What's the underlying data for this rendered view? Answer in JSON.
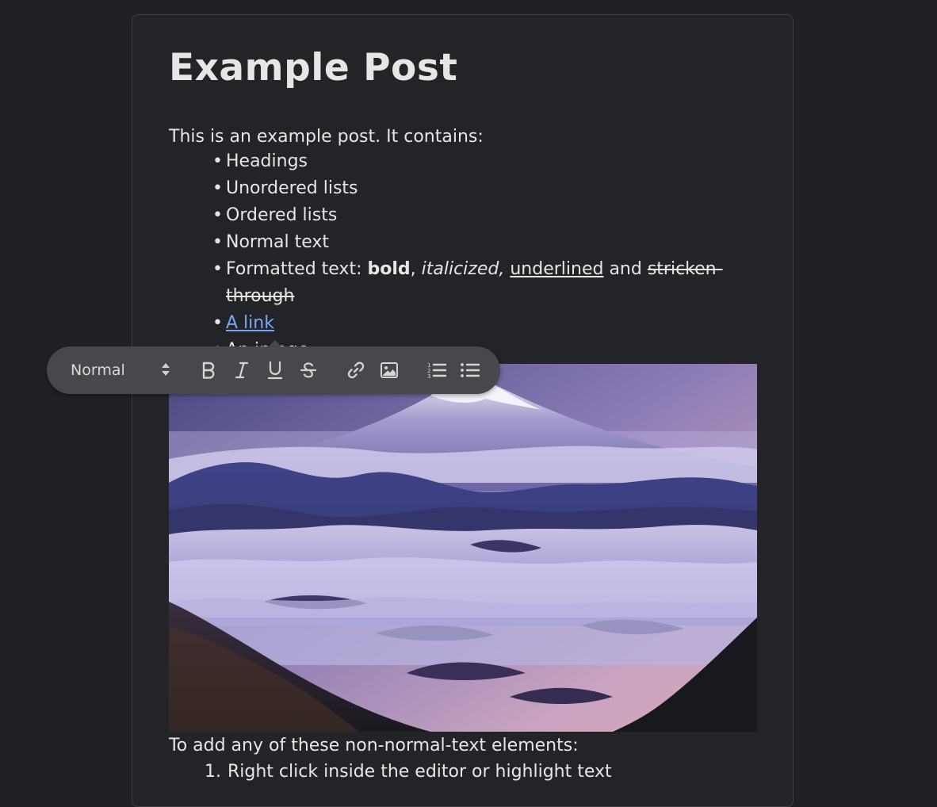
{
  "post": {
    "title": "Example Post",
    "intro": "This is an example post. It contains:",
    "items": [
      "Headings",
      "Unordered lists",
      "Ordered lists",
      "Normal text"
    ],
    "formatted": {
      "prefix": "Formatted text: ",
      "bold": "bold",
      "comma1": ", ",
      "italic": "italicized,",
      "space1": " ",
      "underline": "underlined",
      "and": " and ",
      "strike": "stricken-through"
    },
    "link_text": "A link",
    "clipped_item": "An image",
    "outro": "To add any of these non-normal-text elements:",
    "steps": [
      {
        "num": "1.",
        "text": "Right click inside the editor or highlight text"
      }
    ]
  },
  "toolbar": {
    "block_type": "Normal",
    "buttons": [
      "bold-icon",
      "italic-icon",
      "underline-icon",
      "strikethrough-icon",
      "link-icon",
      "image-icon",
      "ordered-list-icon",
      "unordered-list-icon"
    ]
  },
  "colors": {
    "background": "#1f2125",
    "card": "#222428",
    "toolbar": "#47484b",
    "link": "#7aa6f5",
    "text": "#e6e6e6"
  }
}
